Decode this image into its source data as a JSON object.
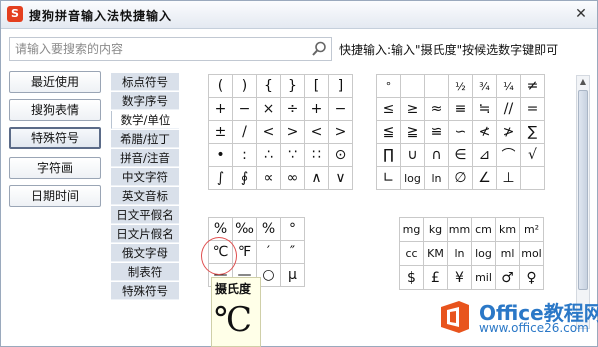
{
  "window": {
    "title": "搜狗拼音输入法快捷输入",
    "app_icon_letter": "S",
    "close_glyph": "✕"
  },
  "search": {
    "placeholder": "请输入要搜索的内容",
    "icon": "search-icon"
  },
  "hint": "快捷输入:输入\"摄氏度\"按候选数字键即可",
  "left_nav": [
    {
      "label": "最近使用",
      "active": false
    },
    {
      "label": "搜狗表情",
      "active": false
    },
    {
      "label": "特殊符号",
      "active": true
    },
    {
      "label": "字符画",
      "active": false
    },
    {
      "label": "日期时间",
      "active": false
    }
  ],
  "categories": [
    {
      "label": "标点符号",
      "active": false
    },
    {
      "label": "数字序号",
      "active": false
    },
    {
      "label": "数学/单位",
      "active": true
    },
    {
      "label": "希腊/拉丁",
      "active": false
    },
    {
      "label": "拼音/注音",
      "active": false
    },
    {
      "label": "中文字符",
      "active": false
    },
    {
      "label": "英文音标",
      "active": false
    },
    {
      "label": "日文平假名",
      "active": false
    },
    {
      "label": "日文片假名",
      "active": false
    },
    {
      "label": "俄文字母",
      "active": false
    },
    {
      "label": "制表符",
      "active": false
    },
    {
      "label": "特殊符号",
      "active": false
    }
  ],
  "grids": {
    "math1": [
      "(",
      ")",
      "{",
      "}",
      "[",
      "]",
      "+",
      "−",
      "×",
      "÷",
      "+",
      "−",
      "±",
      "/",
      "<",
      ">",
      "<",
      ">",
      "•",
      ":",
      "∴",
      "∵",
      "∷",
      "⊙",
      "∫",
      "∮",
      "∝",
      "∞",
      "∧",
      "∨"
    ],
    "math2": [
      "°",
      "",
      "",
      "½",
      "¾",
      "¼",
      "≠",
      "≤",
      "≥",
      "≈",
      "≡",
      "≒",
      "//",
      "=",
      "≦",
      "≧",
      "≌",
      "∽",
      "≮",
      "≯",
      "∑",
      "∏",
      "∪",
      "∩",
      "∈",
      "⊿",
      "⌒",
      "√",
      "∟",
      "log",
      "ln",
      "∅",
      "∠",
      "⊥"
    ],
    "units1": [
      "%",
      "‰",
      "%",
      "°",
      "℃",
      "℉",
      "′",
      "″",
      "—",
      "—",
      "○",
      "μ"
    ],
    "units2": [
      "mg",
      "kg",
      "mm",
      "cm",
      "km",
      "m²",
      "cc",
      "KM",
      "ln",
      "log",
      "ml",
      "mol",
      "$",
      "£",
      "¥",
      "mil",
      "♂",
      "♀"
    ]
  },
  "tooltip": {
    "title": "摄氏度",
    "symbol": "℃"
  },
  "watermark": {
    "name": "Office教程网",
    "url": "www.office26.com",
    "color": "#2b78c7",
    "logo_color": "#e8541d"
  }
}
